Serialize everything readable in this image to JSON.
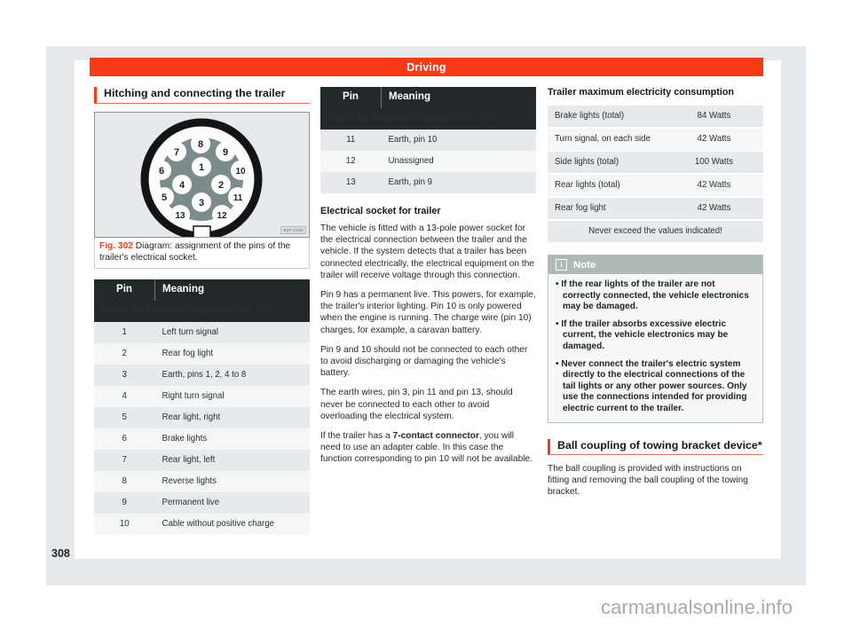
{
  "header": {
    "running_title": "Driving"
  },
  "page": {
    "number": "308",
    "watermark": "carmanualsonline.info"
  },
  "col1": {
    "section_title": "Hitching and connecting the trailer",
    "figure": {
      "code": "B5F-1148",
      "caption_label": "Fig. 302",
      "caption_text": "Diagram: assignment of the pins of the trailer's electrical socket.",
      "pins": [
        "1",
        "2",
        "3",
        "4",
        "5",
        "6",
        "7",
        "8",
        "9",
        "10",
        "11",
        "12",
        "13"
      ]
    },
    "table": {
      "caption": "Key of the Schematic diagram ››› Fig. 302:",
      "headers": [
        "Pin",
        "Meaning"
      ],
      "rows": [
        [
          "1",
          "Left turn signal"
        ],
        [
          "2",
          "Rear fog light"
        ],
        [
          "3",
          "Earth, pins 1, 2, 4 to 8"
        ],
        [
          "4",
          "Right turn signal"
        ],
        [
          "5",
          "Rear light, right"
        ],
        [
          "6",
          "Brake lights"
        ],
        [
          "7",
          "Rear light, left"
        ],
        [
          "8",
          "Reverse lights"
        ],
        [
          "9",
          "Permanent live"
        ],
        [
          "10",
          "Cable without positive charge"
        ]
      ]
    }
  },
  "col2": {
    "table": {
      "caption": "Key of the Schematic diagram ››› Fig. 302:",
      "headers": [
        "Pin",
        "Meaning"
      ],
      "rows": [
        [
          "11",
          "Earth, pin 10"
        ],
        [
          "12",
          "Unassigned"
        ],
        [
          "13",
          "Earth, pin 9"
        ]
      ]
    },
    "sub_head": "Electrical socket for trailer",
    "paragraphs": [
      "The vehicle is fitted with a 13-pole power socket for the electrical connection between the trailer and the vehicle. If the system detects that a trailer has been connected electrically, the electrical equipment on the trailer will receive voltage through this connection.",
      "Pin 9 has a permanent live. This powers, for example, the trailer's interior lighting. Pin 10 is only powered when the engine is running. The charge wire (pin 10) charges, for example, a caravan battery.",
      "Pin 9 and 10 should not be connected to each other to avoid discharging or damaging the vehicle's battery.",
      "The earth wires, pin 3, pin 11 and pin 13, should never be connected to each other to avoid overloading the electrical system."
    ],
    "last_paragraph": {
      "before": "If the trailer has a ",
      "bold": "7-contact connector",
      "after": ", you will need to use an adapter cable. In this case the function corresponding to pin 10 will not be available."
    }
  },
  "col3": {
    "sub_head": "Trailer maximum electricity consumption",
    "table": {
      "rows": [
        [
          "Brake lights (total)",
          "84 Watts"
        ],
        [
          "Turn signal, on each side",
          "42 Watts"
        ],
        [
          "Side lights (total)",
          "100 Watts"
        ],
        [
          "Rear lights (total)",
          "42 Watts"
        ],
        [
          "Rear fog light",
          "42 Watts"
        ]
      ],
      "footer": "Never exceed the values indicated!"
    },
    "note": {
      "title": "Note",
      "icon": "i",
      "items": [
        "• If the rear lights of the trailer are not correctly connected, the vehicle electronics may be damaged.",
        "• If the trailer absorbs excessive electric current, the vehicle electronics may be damaged.",
        "• Never connect the trailer's electric system directly to the electrical connections of the tail lights or any other power sources. Only use the connections intended for providing electric current to the trailer."
      ]
    },
    "section_title": "Ball coupling of towing bracket device*",
    "paragraph": "The ball coupling is provided with instructions on fitting and removing the ball coupling of the towing bracket."
  },
  "colors": {
    "accent": "#f93a16",
    "dark": "#23282b",
    "frame": "#e6eaec",
    "note_head": "#aeb9b8"
  }
}
